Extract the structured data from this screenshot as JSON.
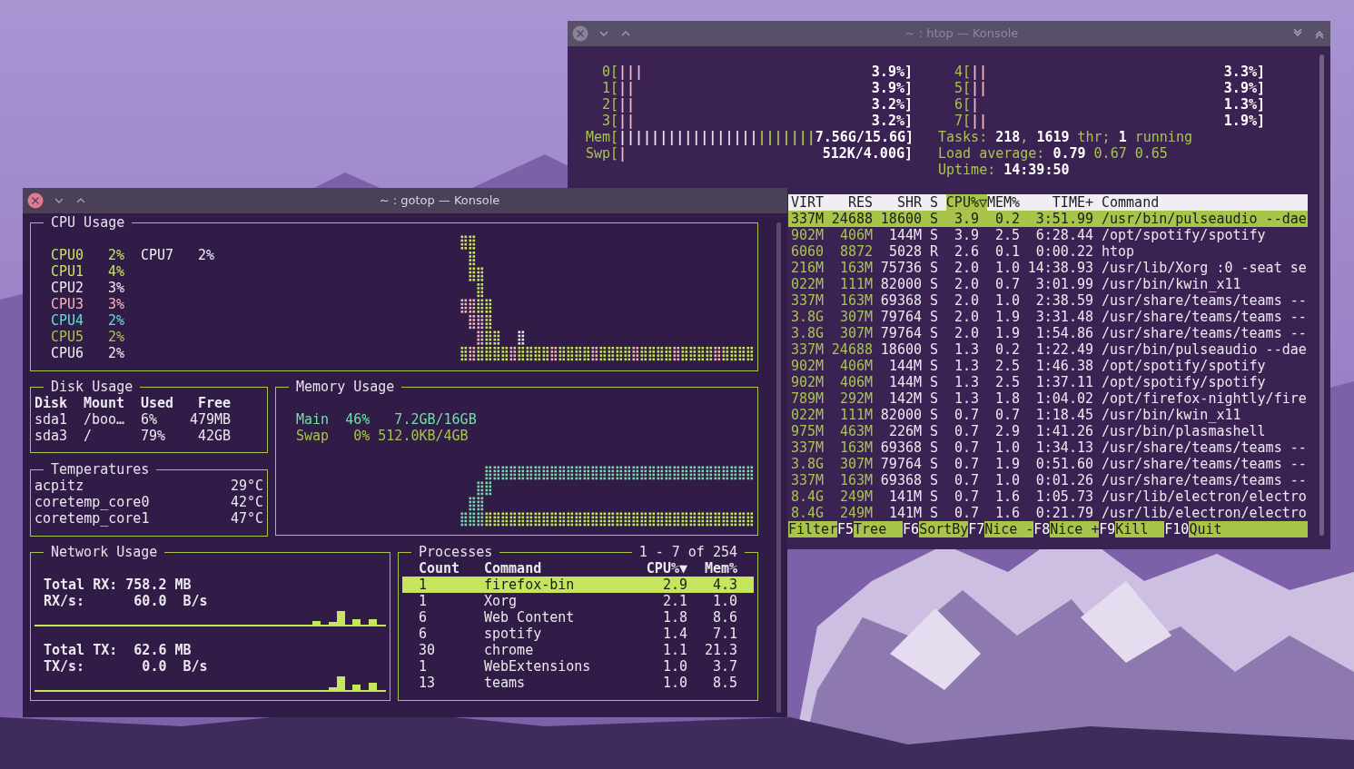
{
  "htop_window": {
    "title": "~ : htop — Konsole",
    "cpu_meters_left": [
      {
        "label": "0[",
        "bars": [
          {
            "text": "|||",
            "color": "#f2b8c4"
          }
        ],
        "reading": "3.9%]"
      },
      {
        "label": "1[",
        "bars": [
          {
            "text": "||",
            "color": "#f2b8c4"
          }
        ],
        "reading": "3.9%]"
      },
      {
        "label": "2[",
        "bars": [
          {
            "text": "||",
            "color": "#f2b8c4"
          }
        ],
        "reading": "3.2%]"
      },
      {
        "label": "3[",
        "bars": [
          {
            "text": "||",
            "color": "#f2b8c4"
          }
        ],
        "reading": "3.2%]"
      }
    ],
    "memory_meters": [
      {
        "label": "Mem[",
        "bars": [
          {
            "text": "|||||||||||||||||",
            "color": "#e8e0ee"
          },
          {
            "text": "|||||||",
            "color": "#a8c44a"
          }
        ],
        "reading": "7.56G/15.6G]"
      },
      {
        "label": "Swp[",
        "bars": [
          {
            "text": "|",
            "color": "#f2b8c4"
          }
        ],
        "reading": "512K/4.00G]"
      }
    ],
    "cpu_meters_right": [
      {
        "label": "4[",
        "bars": [
          {
            "text": "||",
            "color": "#f2b8c4"
          }
        ],
        "reading": "3.3%]"
      },
      {
        "label": "5[",
        "bars": [
          {
            "text": "||",
            "color": "#f2b8c4"
          }
        ],
        "reading": "3.9%]"
      },
      {
        "label": "6[",
        "bars": [
          {
            "text": "|",
            "color": "#f2b8c4"
          }
        ],
        "reading": "1.3%]"
      },
      {
        "label": "7[",
        "bars": [
          {
            "text": "||",
            "color": "#f2b8c4"
          }
        ],
        "reading": "1.9%]"
      }
    ],
    "tasks": "Tasks: **218**, **1619** thr; **1** running",
    "load_average": "Load average: **0.79** 0.67 0.65",
    "uptime": "Uptime: **14:39:50**",
    "columns": [
      {
        "label": "VIRT",
        "selected": false
      },
      {
        "label": "RES",
        "selected": false
      },
      {
        "label": "SHR",
        "selected": false
      },
      {
        "label": "S",
        "selected": false
      },
      {
        "label": "CPU%▽",
        "selected": true
      },
      {
        "label": "MEM%",
        "selected": false
      },
      {
        "label": "TIME+",
        "selected": false
      },
      {
        "label": "Command",
        "selected": false
      }
    ],
    "rows": [
      {
        "virt": "337M",
        "res": "24688",
        "shr": "18600",
        "state": "S",
        "cpu": "3.9",
        "mem": "0.2",
        "time": "3:51.99",
        "command": "/usr/bin/pulseaudio --dae",
        "selected": true
      },
      {
        "virt": "902M",
        "res": "406M",
        "shr": "144M",
        "state": "S",
        "cpu": "3.9",
        "mem": "2.5",
        "time": "6:28.44",
        "command": "/opt/spotify/spotify",
        "selected": false
      },
      {
        "virt": "6060",
        "res": "8872",
        "shr": "5028",
        "state": "R",
        "cpu": "2.6",
        "mem": "0.1",
        "time": "0:00.22",
        "command": "htop",
        "selected": false
      },
      {
        "virt": "216M",
        "res": "163M",
        "shr": "75736",
        "state": "S",
        "cpu": "2.0",
        "mem": "1.0",
        "time": "14:38.93",
        "command": "/usr/lib/Xorg :0 -seat se",
        "selected": false
      },
      {
        "virt": "022M",
        "res": "111M",
        "shr": "82000",
        "state": "S",
        "cpu": "2.0",
        "mem": "0.7",
        "time": "3:01.99",
        "command": "/usr/bin/kwin_x11",
        "selected": false
      },
      {
        "virt": "337M",
        "res": "163M",
        "shr": "69368",
        "state": "S",
        "cpu": "2.0",
        "mem": "1.0",
        "time": "2:38.59",
        "command": "/usr/share/teams/teams --",
        "selected": false
      },
      {
        "virt": "3.8G",
        "res": "307M",
        "shr": "79764",
        "state": "S",
        "cpu": "2.0",
        "mem": "1.9",
        "time": "3:31.48",
        "command": "/usr/share/teams/teams --",
        "selected": false
      },
      {
        "virt": "3.8G",
        "res": "307M",
        "shr": "79764",
        "state": "S",
        "cpu": "2.0",
        "mem": "1.9",
        "time": "1:54.86",
        "command": "/usr/share/teams/teams --",
        "selected": false
      },
      {
        "virt": "337M",
        "res": "24688",
        "shr": "18600",
        "state": "S",
        "cpu": "1.3",
        "mem": "0.2",
        "time": "1:22.49",
        "command": "/usr/bin/pulseaudio --dae",
        "selected": false
      },
      {
        "virt": "902M",
        "res": "406M",
        "shr": "144M",
        "state": "S",
        "cpu": "1.3",
        "mem": "2.5",
        "time": "1:46.38",
        "command": "/opt/spotify/spotify",
        "selected": false
      },
      {
        "virt": "902M",
        "res": "406M",
        "shr": "144M",
        "state": "S",
        "cpu": "1.3",
        "mem": "2.5",
        "time": "1:37.11",
        "command": "/opt/spotify/spotify",
        "selected": false
      },
      {
        "virt": "789M",
        "res": "292M",
        "shr": "142M",
        "state": "S",
        "cpu": "1.3",
        "mem": "1.8",
        "time": "1:04.02",
        "command": "/opt/firefox-nightly/fire",
        "selected": false
      },
      {
        "virt": "022M",
        "res": "111M",
        "shr": "82000",
        "state": "S",
        "cpu": "0.7",
        "mem": "0.7",
        "time": "1:18.45",
        "command": "/usr/bin/kwin_x11",
        "selected": false
      },
      {
        "virt": "975M",
        "res": "463M",
        "shr": "226M",
        "state": "S",
        "cpu": "0.7",
        "mem": "2.9",
        "time": "1:41.26",
        "command": "/usr/bin/plasmashell",
        "selected": false
      },
      {
        "virt": "337M",
        "res": "163M",
        "shr": "69368",
        "state": "S",
        "cpu": "0.7",
        "mem": "1.0",
        "time": "1:34.13",
        "command": "/usr/share/teams/teams --",
        "selected": false
      },
      {
        "virt": "3.8G",
        "res": "307M",
        "shr": "79764",
        "state": "S",
        "cpu": "0.7",
        "mem": "1.9",
        "time": "0:51.60",
        "command": "/usr/share/teams/teams --",
        "selected": false
      },
      {
        "virt": "337M",
        "res": "163M",
        "shr": "69368",
        "state": "S",
        "cpu": "0.7",
        "mem": "1.0",
        "time": "0:01.26",
        "command": "/usr/share/teams/teams --",
        "selected": false
      },
      {
        "virt": "8.4G",
        "res": "249M",
        "shr": "141M",
        "state": "S",
        "cpu": "0.7",
        "mem": "1.6",
        "time": "1:05.73",
        "command": "/usr/lib/electron/electro",
        "selected": false
      },
      {
        "virt": "8.4G",
        "res": "249M",
        "shr": "141M",
        "state": "S",
        "cpu": "0.7",
        "mem": "1.6",
        "time": "0:21.79",
        "command": "/usr/lib/electron/electro",
        "selected": false
      }
    ],
    "function_keys": [
      {
        "label": "Filter"
      },
      {
        "key": "F5",
        "label": "Tree"
      },
      {
        "key": "F6",
        "label": "SortBy"
      },
      {
        "key": "F7",
        "label": "Nice -"
      },
      {
        "key": "F8",
        "label": "Nice +"
      },
      {
        "key": "F9",
        "label": "Kill"
      },
      {
        "key": "F10",
        "label": "Quit"
      }
    ]
  },
  "gotop_window": {
    "title": "~ : gotop — Konsole",
    "cpu_usage": {
      "title": "CPU Usage",
      "cpus": [
        {
          "name": "CPU0",
          "value": "2%",
          "color": "#c5e65c"
        },
        {
          "name": "CPU1",
          "value": "4%",
          "color": "#c5e65c"
        },
        {
          "name": "CPU2",
          "value": "3%",
          "color": "#f0eef4"
        },
        {
          "name": "CPU3",
          "value": "3%",
          "color": "#f4b8b8"
        },
        {
          "name": "CPU4",
          "value": "2%",
          "color": "#5ee0d6"
        },
        {
          "name": "CPU5",
          "value": "2%",
          "color": "#a8c44a"
        },
        {
          "name": "CPU6",
          "value": "2%",
          "color": "#f0eef4"
        },
        {
          "name": "CPU7",
          "value": "2%",
          "color": "#f0eef4"
        }
      ]
    },
    "disk_usage": {
      "title": "Disk Usage",
      "columns": [
        "Disk",
        "Mount",
        "Used",
        "Free"
      ],
      "rows": [
        [
          "sda1",
          "/boo…",
          "6%",
          "479MB"
        ],
        [
          "sda3",
          "/",
          "79%",
          "42GB"
        ]
      ]
    },
    "temperatures": {
      "title": "Temperatures",
      "sensors": [
        {
          "name": "acpitz",
          "value": "29°C"
        },
        {
          "name": "coretemp_core0",
          "value": "42°C"
        },
        {
          "name": "coretemp_core1",
          "value": "47°C"
        }
      ]
    },
    "memory_usage": {
      "title": "Memory Usage",
      "items": [
        {
          "text": "Main  46%   7.2GB/16GB",
          "color": "#6ee0a8"
        },
        {
          "text": "Swap   0% 512.0KB/4GB",
          "color": "#a8c44a"
        }
      ]
    },
    "network_usage": {
      "title": "Network Usage",
      "rx_total": "Total RX: 758.2 MB",
      "rx_rate": "RX/s:      60.0  B/s",
      "tx_total": "Total TX:  62.6 MB",
      "tx_rate": "TX/s:       0.0  B/s"
    },
    "processes": {
      "title": "Processes",
      "range": "1 - 7 of 254",
      "columns": [
        "Count",
        "Command",
        "CPU%▼",
        "Mem%"
      ],
      "rows": [
        {
          "count": "1",
          "command": "firefox-bin",
          "cpu": "2.9",
          "mem": "4.3",
          "selected": true
        },
        {
          "count": "1",
          "command": "Xorg",
          "cpu": "2.1",
          "mem": "1.0",
          "selected": false
        },
        {
          "count": "6",
          "command": "Web Content",
          "cpu": "1.8",
          "mem": "8.6",
          "selected": false
        },
        {
          "count": "6",
          "command": "spotify",
          "cpu": "1.4",
          "mem": "7.1",
          "selected": false
        },
        {
          "count": "30",
          "command": "chrome",
          "cpu": "1.1",
          "mem": "21.3",
          "selected": false
        },
        {
          "count": "1",
          "command": "WebExtensions",
          "cpu": "1.0",
          "mem": "3.7",
          "selected": false
        },
        {
          "count": "13",
          "command": "teams",
          "cpu": "1.0",
          "mem": "8.5",
          "selected": false
        }
      ]
    }
  }
}
